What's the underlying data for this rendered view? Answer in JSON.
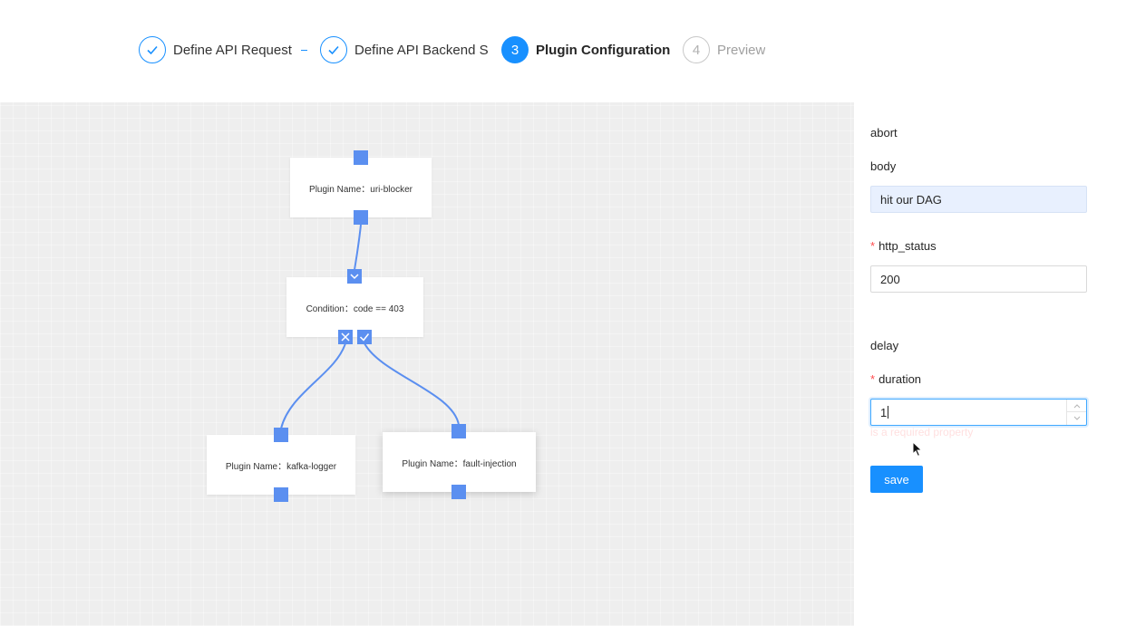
{
  "steps": [
    {
      "label": "Define API Request",
      "state": "done"
    },
    {
      "label": "Define API Backend Server",
      "state": "done"
    },
    {
      "label": "Plugin Configuration",
      "state": "active",
      "number": "3"
    },
    {
      "label": "Preview",
      "state": "wait",
      "number": "4"
    }
  ],
  "canvas": {
    "nodes": {
      "uri_blocker": "Plugin Name：uri-blocker",
      "condition": "Condition：code == 403",
      "kafka_logger": "Plugin Name：kafka-logger",
      "fault_injection": "Plugin Name：fault-injection"
    }
  },
  "form": {
    "abort_section": "abort",
    "body_label": "body",
    "body_value": "hit our DAG",
    "http_status_label": "http_status",
    "http_status_value": "200",
    "delay_section": "delay",
    "duration_label": "duration",
    "duration_value": "1",
    "duration_error": "is a required property",
    "required_mark": "*",
    "save_label": "save"
  },
  "colors": {
    "primary": "#1890ff",
    "port": "#5b8ff0",
    "edge": "#5b8ff0",
    "required": "#ff4d4f"
  }
}
